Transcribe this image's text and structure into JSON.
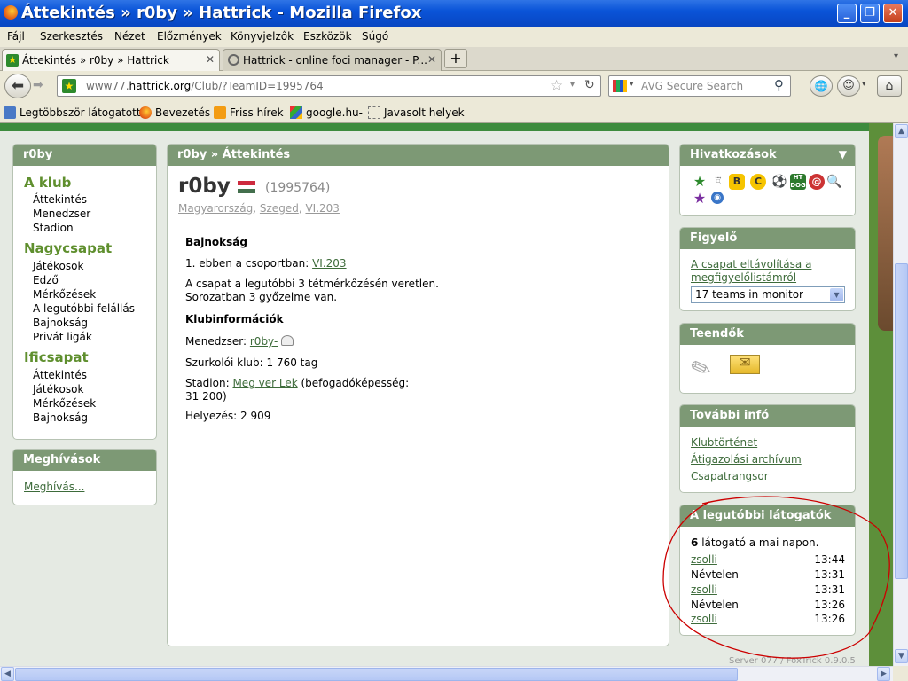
{
  "window": {
    "title": "Áttekintés » r0by » Hattrick - Mozilla Firefox",
    "buttons": {
      "minimize": "_",
      "maximize": "❐",
      "close": "✕"
    }
  },
  "menu": [
    "Fájl",
    "Szerkesztés",
    "Nézet",
    "Előzmények",
    "Könyvjelzők",
    "Eszközök",
    "Súgó"
  ],
  "tabs": [
    {
      "label": "Áttekintés » r0by » Hattrick",
      "active": true
    },
    {
      "label": "Hattrick - online foci manager - P...",
      "active": false
    }
  ],
  "new_tab": "+",
  "nav": {
    "url_prefix": "www77.",
    "url_host": "hattrick.org",
    "url_path": "/Club/?TeamID=1995764",
    "search_placeholder": "AVG Secure Search"
  },
  "bookmarks": [
    "Legtöbbször látogatott",
    "Bevezetés",
    "Friss hírek",
    "google.hu-",
    "Javasolt helyek"
  ],
  "left": {
    "title": "r0by",
    "sections": [
      {
        "heading": "A klub",
        "items": [
          "Áttekintés",
          "Menedzser",
          "Stadion"
        ]
      },
      {
        "heading": "Nagycsapat",
        "items": [
          "Játékosok",
          "Edző",
          "Mérkőzések",
          "A legutóbbi felállás",
          "Bajnokság",
          "Privát ligák"
        ]
      },
      {
        "heading": "Ificsapat",
        "items": [
          "Áttekintés",
          "Játékosok",
          "Mérkőzések",
          "Bajnokság"
        ]
      }
    ],
    "invites": {
      "title": "Meghívások",
      "link": "Meghívás..."
    }
  },
  "center": {
    "breadcrumb": "r0by » Áttekintés",
    "club_name": "r0by",
    "team_id": "(1995764)",
    "location": {
      "country": "Magyarország",
      "city": "Szeged",
      "league": "VI.203"
    },
    "league_heading": "Bajnokság",
    "position_text": "1. ebben a csoportban:",
    "position_link": "VI.203",
    "unbeaten_line1": "A csapat a legutóbbi 3 tétmérkőzésén veretlen.",
    "unbeaten_line2": "Sorozatban 3 győzelme van.",
    "club_info_heading": "Klubinformációk",
    "manager_label": "Menedzser:",
    "manager_link": "r0by-",
    "fans_text": "Szurkolói klub: 1 760 tag",
    "stadium_label": "Stadion:",
    "stadium_link": "Meg ver Lek",
    "stadium_cap1": "(befogadóképesség:",
    "stadium_cap2": "31 200)",
    "rank_text": "Helyezés: 2 909"
  },
  "right": {
    "links_title": "Hivatkozások",
    "monitor": {
      "title": "Figyelő",
      "remove_link": "A csapat eltávolítása a megfigyelőlistámról",
      "select_value": "17 teams in monitor"
    },
    "todo_title": "Teendők",
    "more_info": {
      "title": "További infó",
      "links": [
        "Klubtörténet",
        "Átigazolási archívum",
        "Csapatrangsor"
      ]
    },
    "visitors": {
      "title": "A legutóbbi látogatók",
      "count": "6",
      "count_text": "látogató a mai napon.",
      "rows": [
        {
          "name": "zsolli",
          "time": "13:44"
        },
        {
          "name": "Névtelen",
          "time": "13:31"
        },
        {
          "name": "zsolli",
          "time": "13:31"
        },
        {
          "name": "Névtelen",
          "time": "13:26"
        },
        {
          "name": "zsolli",
          "time": "13:26"
        }
      ]
    }
  },
  "footer": {
    "server": "Server 077 / FoxTrick 0.9.0.5"
  },
  "colors": {
    "box_header": "#7d9975",
    "link": "#3d6b3a",
    "section_green": "#5f8f2e",
    "page_bg": "#e5eae3",
    "annotation": "#cc0000"
  }
}
